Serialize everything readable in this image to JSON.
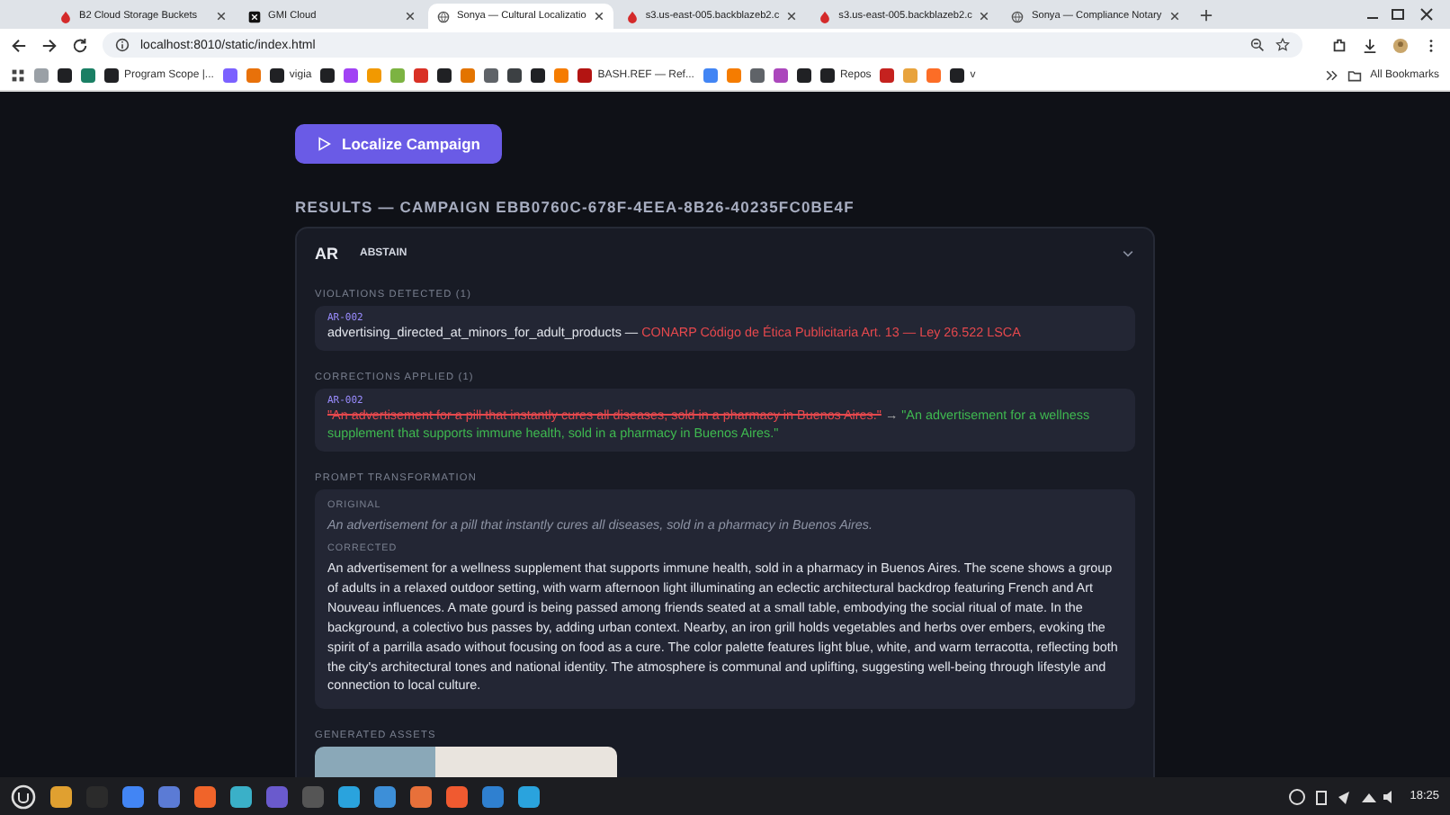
{
  "browser": {
    "tabs": [
      {
        "title": "B2 Cloud Storage Buckets",
        "kind": "flame",
        "selected": false
      },
      {
        "title": "GMI Cloud",
        "kind": "square",
        "selected": false
      },
      {
        "title": "Sonya — Cultural Localizatio",
        "kind": "globe",
        "selected": true
      },
      {
        "title": "s3.us-east-005.backblazeb2.c",
        "kind": "flame",
        "selected": false
      },
      {
        "title": "s3.us-east-005.backblazeb2.c",
        "kind": "flame",
        "selected": false
      },
      {
        "title": "Sonya — Compliance Notary",
        "kind": "globe",
        "selected": false
      }
    ],
    "address": "localhost:8010/static/index.html",
    "bookmarks": [
      {
        "color": "#9aa0a6"
      },
      {
        "color": "#202124"
      },
      {
        "color": "#1a7f64"
      },
      {
        "label": "Program Scope |...",
        "color": "#202124"
      },
      {
        "color": "#7b61ff"
      },
      {
        "color": "#e8710a"
      },
      {
        "label": "vigia",
        "color": "#202124"
      },
      {
        "color": "#202124"
      },
      {
        "color": "#a142f4"
      },
      {
        "color": "#f29900"
      },
      {
        "color": "#7cb342"
      },
      {
        "color": "#d93025"
      },
      {
        "color": "#202124"
      },
      {
        "color": "#e37400"
      },
      {
        "color": "#5f6368"
      },
      {
        "color": "#3c4043"
      },
      {
        "color": "#202124"
      },
      {
        "color": "#f57c00"
      },
      {
        "label": "BASH.REF — Ref...",
        "color": "#b31412"
      },
      {
        "color": "#4285f4"
      },
      {
        "color": "#f57c00"
      },
      {
        "color": "#5f6368"
      },
      {
        "color": "#ab47bc"
      },
      {
        "color": "#202124"
      },
      {
        "label": "Repos",
        "color": "#202124"
      },
      {
        "color": "#c5221f"
      },
      {
        "color": "#e8a33d"
      },
      {
        "color": "#fc6d26"
      },
      {
        "label": "v",
        "color": "#202124"
      }
    ],
    "all_bookmarks": "All Bookmarks"
  },
  "page": {
    "action_button": "Localize Campaign",
    "results_title": "RESULTS — CAMPAIGN EBB0760C-678F-4EEA-8B26-40235FC0BE4F",
    "market": {
      "code": "AR",
      "status": "ABSTAIN",
      "expanded": true
    },
    "violations": {
      "heading": "VIOLATIONS DETECTED (1)",
      "items": [
        {
          "code": "AR-002",
          "rule": "advertising_directed_at_minors_for_adult_products",
          "separator": "—",
          "reference": "CONARP Código de Ética Publicitaria Art. 13 — Ley 26.522 LSCA"
        }
      ]
    },
    "corrections": {
      "heading": "CORRECTIONS APPLIED (1)",
      "items": [
        {
          "code": "AR-002",
          "before": "\"An advertisement for a pill that instantly cures all diseases, sold in a pharmacy in Buenos Aires.\"",
          "arrow": "→",
          "after": "\"An advertisement for a wellness supplement that supports immune health, sold in a pharmacy in Buenos Aires.\""
        }
      ]
    },
    "prompt": {
      "heading": "PROMPT TRANSFORMATION",
      "original_label": "ORIGINAL",
      "original": "An advertisement for a pill that instantly cures all diseases, sold in a pharmacy in Buenos Aires.",
      "corrected_label": "CORRECTED",
      "corrected": "An advertisement for a wellness supplement that supports immune health, sold in a pharmacy in Buenos Aires. The scene shows a group of adults in a relaxed outdoor setting, with warm afternoon light illuminating an eclectic architectural backdrop featuring French and Art Nouveau influences. A mate gourd is being passed among friends seated at a small table, embodying the social ritual of mate. In the background, a colectivo bus passes by, adding urban context. Nearby, an iron grill holds vegetables and herbs over embers, evoking the spirit of a parrilla asado without focusing on food as a cure. The color palette features light blue, white, and warm terracotta, reflecting both the city's architectural tones and national identity. The atmosphere is communal and uplifting, suggesting well-being through lifestyle and connection to local culture."
    },
    "assets": {
      "heading": "GENERATED ASSETS"
    }
  },
  "taskbar": {
    "apps": [
      {
        "color": "#e0a030"
      },
      {
        "color": "#2b2b2b"
      },
      {
        "color": "#4285f4"
      },
      {
        "color": "#5b7bd5"
      },
      {
        "color": "#f0642a"
      },
      {
        "color": "#3ab0c8"
      },
      {
        "color": "#6a5acd"
      },
      {
        "color": "#555555"
      },
      {
        "color": "#2aa3dd"
      },
      {
        "color": "#3d8fd8"
      },
      {
        "color": "#e8703a"
      },
      {
        "color": "#f05a30"
      },
      {
        "color": "#2f80d0"
      },
      {
        "color": "#2aa3dd"
      }
    ],
    "clock": "18:25"
  }
}
